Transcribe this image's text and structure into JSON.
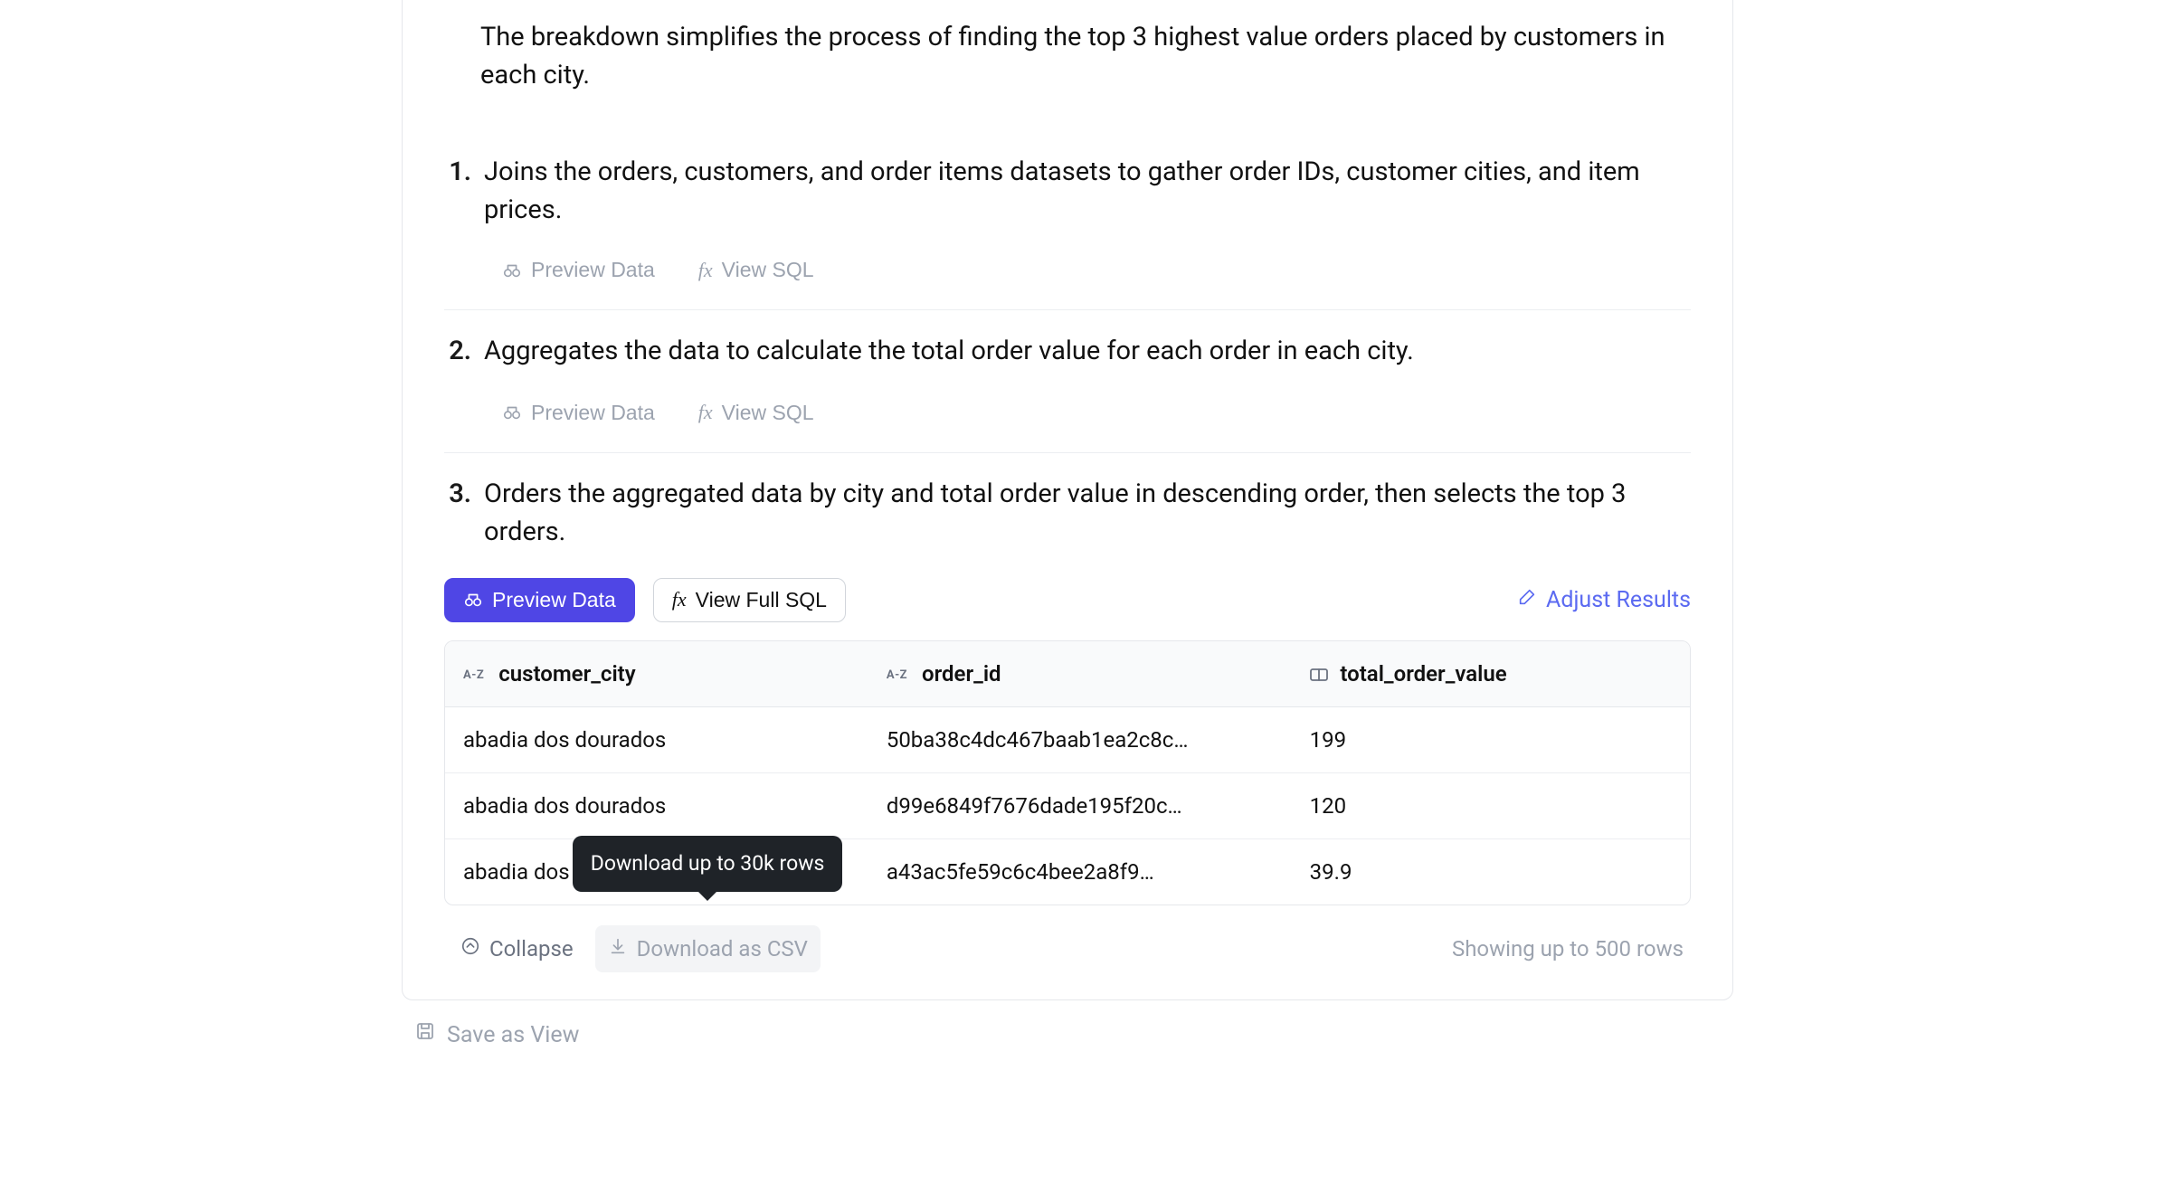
{
  "intro": "The breakdown simplifies the process of finding the top 3 highest value orders placed by customers in each city.",
  "steps": [
    {
      "num": "1.",
      "text": "Joins the orders, customers, and order items datasets to gather order IDs, customer cities, and item prices.",
      "preview_label": "Preview Data",
      "sql_label": "View SQL"
    },
    {
      "num": "2.",
      "text": "Aggregates the data to calculate the total order value for each order in each city.",
      "preview_label": "Preview Data",
      "sql_label": "View SQL"
    },
    {
      "num": "3.",
      "text": "Orders the aggregated data by city and total order value in descending order, then selects the top 3 orders.",
      "preview_label": "Preview Data",
      "sql_label": "View Full SQL"
    }
  ],
  "adjust_label": "Adjust Results",
  "table": {
    "columns": {
      "city": "customer_city",
      "order": "order_id",
      "value": "total_order_value"
    },
    "rows": [
      {
        "city": "abadia dos dourados",
        "order": "50ba38c4dc467baab1ea2c8c…",
        "value": "199"
      },
      {
        "city": "abadia dos dourados",
        "order": "d99e6849f7676dade195f20c…",
        "value": "120"
      },
      {
        "city": "abadia dos dourados",
        "order": "a43ac5fe59c6c4bee2a8f9…",
        "value": "39.9"
      }
    ]
  },
  "footer": {
    "collapse": "Collapse",
    "download": "Download as CSV",
    "rows_note": "Showing up to 500 rows"
  },
  "tooltip": "Download up to 30k rows",
  "save_view": "Save as View"
}
